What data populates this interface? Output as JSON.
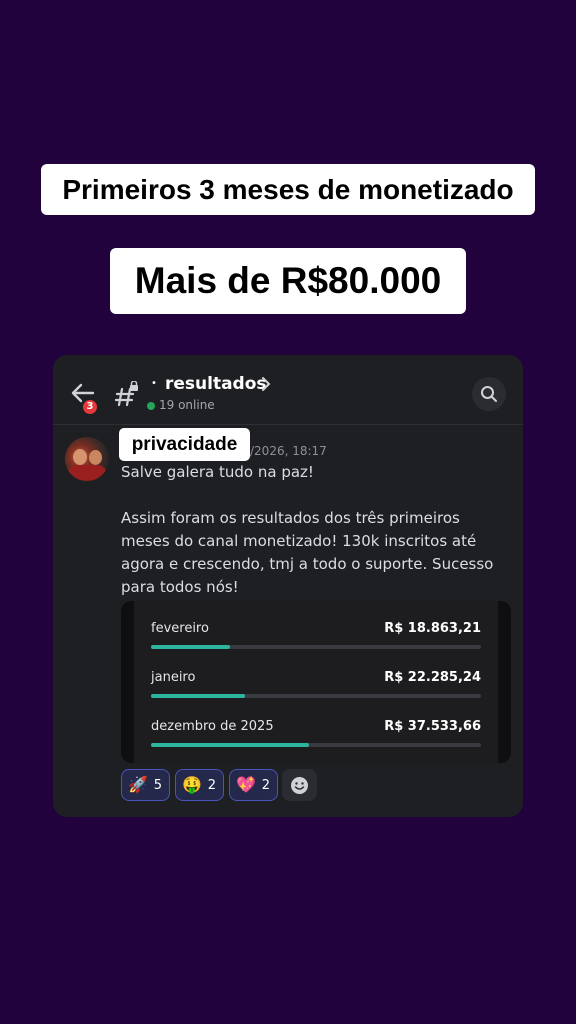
{
  "captions": {
    "top": "Primeiros 3 meses de monetizado",
    "amount": "Mais de R$80.000"
  },
  "header": {
    "back_badge": "3",
    "channel_bullet": "•",
    "channel_name": "resultados",
    "online": "19 online"
  },
  "post": {
    "username_overlay": "privacidade",
    "timestamp": "/2026, 18:17",
    "line1": "Salve galera tudo na paz!",
    "line2": "Assim foram os resultados dos três primeiros meses do canal monetizado! 130k inscritos até agora e crescendo, tmj a todo o suporte. Sucesso para todos nós!"
  },
  "earnings": [
    {
      "month": "fevereiro",
      "amount": "R$ 18.863,21",
      "progress": 0.24
    },
    {
      "month": "janeiro",
      "amount": "R$ 22.285,24",
      "progress": 0.285
    },
    {
      "month": "dezembro de 2025",
      "amount": "R$ 37.533,66",
      "progress": 0.48
    }
  ],
  "reactions": [
    {
      "emoji": "🚀",
      "count": "5"
    },
    {
      "emoji": "🤑",
      "count": "2"
    },
    {
      "emoji": "💖",
      "count": "2"
    }
  ],
  "colors": {
    "background": "#22023c",
    "card": "#1e1f23",
    "progress": "#2bb59e",
    "badge": "#e5393d",
    "online": "#23a55a"
  },
  "icons": [
    "back-arrow-icon",
    "hash-lock-icon",
    "chevron-right-icon",
    "search-icon",
    "avatar",
    "add-reaction-icon"
  ]
}
